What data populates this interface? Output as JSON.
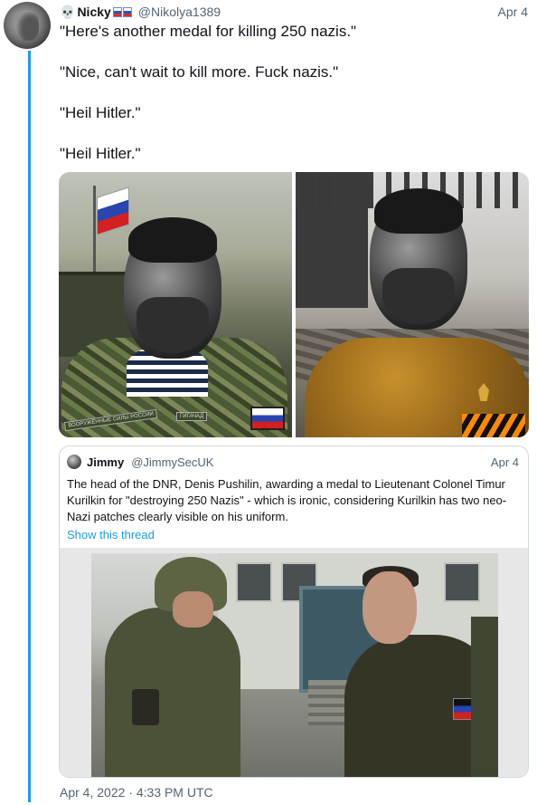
{
  "tweet": {
    "display_name": "Nicky",
    "name_emoji": "💀",
    "handle": "@Nikolya1389",
    "date": "Apr 4",
    "lines": [
      "\"Here's another medal for killing 250 nazis.\"",
      "\"Nice, can't wait to kill more. Fuck nazis.\"",
      "\"Heil Hitler.\"",
      "\"Heil Hitler.\""
    ],
    "photo_left_patches": [
      "ВООРУЖЁННЫЕ СИЛЫ РОССИИ",
      "ГИГАЧАД"
    ],
    "timestamp": "Apr 4, 2022 · 4:33 PM UTC"
  },
  "quote": {
    "display_name": "Jimmy",
    "handle": "@JimmySecUK",
    "date": "Apr 4",
    "text": "The head of the DNR, Denis Pushilin, awarding a medal to Lieutenant Colonel Timur Kurilkin for \"destroying 250 Nazis\" - which is ironic, considering Kurilkin has two neo-Nazi patches clearly visible on his uniform.",
    "show_thread": "Show this thread"
  },
  "colors": {
    "accent": "#1d9bf0",
    "secondary_text": "#536471",
    "border": "#cfd9de"
  }
}
